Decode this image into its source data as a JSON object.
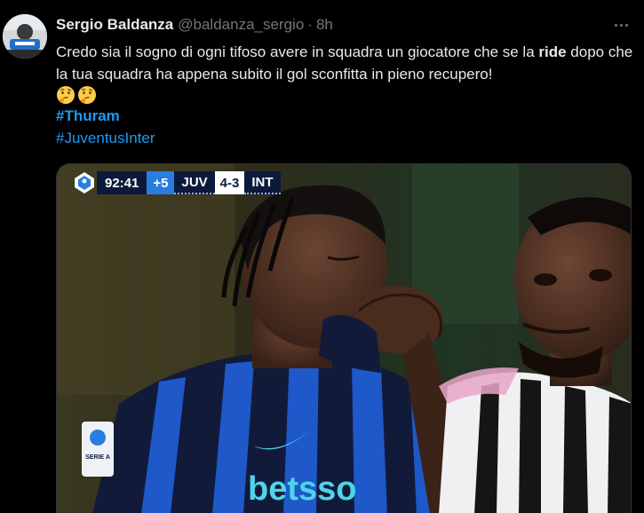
{
  "tweet": {
    "author_name": "Sergio Baldanza",
    "handle": "@baldanza_sergio",
    "separator": "·",
    "time": "8h",
    "text_part1": "Credo sia il sogno di ogni tifoso avere in squadra un giocatore che se la ",
    "text_bold": "ride",
    "text_part2": " dopo che la tua squadra ha appena subito il gol sconfitta in pieno recupero!",
    "emojis": [
      "thinking-face",
      "thinking-face"
    ],
    "hashtags": [
      "#Thuram",
      "#JuventusInter"
    ]
  },
  "media": {
    "scorebug": {
      "clock": "92:41",
      "added_time": "+5",
      "home_team": "JUV",
      "score": "4-3",
      "away_team": "INT"
    },
    "shirt_sponsor": "betsso",
    "badge_text": "SERIE A"
  },
  "colors": {
    "background": "#000000",
    "text": "#e7e9ea",
    "muted": "#71767b",
    "link": "#1d9bf0"
  }
}
